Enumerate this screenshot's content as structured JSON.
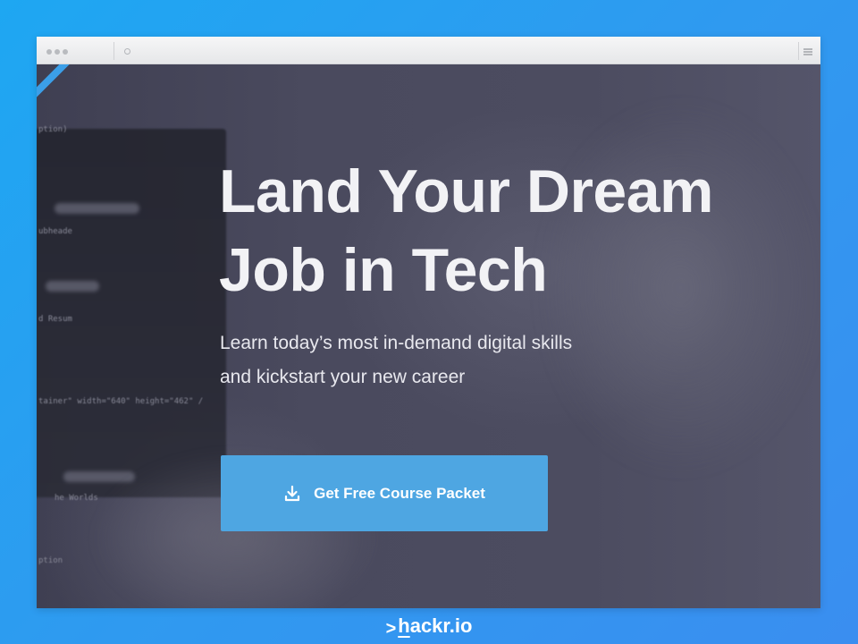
{
  "browser": {
    "menu_icon": "hamburger-menu-icon",
    "reload_icon": "reload-icon"
  },
  "hero": {
    "title_line1": "Land Your Dream",
    "title_line2": "Job in Tech",
    "subtitle_line1": "Learn today’s most in-demand digital skills",
    "subtitle_line2": "and kickstart your new career",
    "cta_label": "Get Free Course Packet",
    "cta_icon": "download-icon"
  },
  "background_code": {
    "lines": [
      "ption)",
      "ubheade",
      "d Resum",
      "tainer\" width=\"640\" height=\"462\" /",
      "he Worlds",
      "ption"
    ]
  },
  "brand": {
    "prompt": ">",
    "name_first": "h",
    "name_rest": "ackr.io"
  },
  "colors": {
    "page_background": "#2f9af0",
    "cta_background": "#4ea6e2",
    "hero_overlay": "#4a4a5e",
    "ribbon": "#3b9fe8",
    "text": "#f2f2f5"
  }
}
